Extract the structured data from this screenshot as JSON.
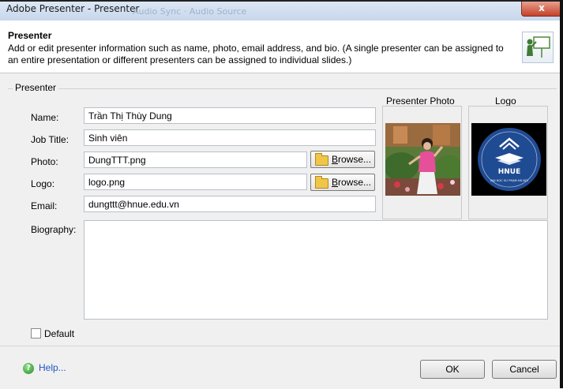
{
  "window": {
    "title": "Adobe Presenter - Presenter",
    "ghost_text": "Audio Sync · Audio Source",
    "close_label": "x"
  },
  "header": {
    "title": "Presenter",
    "description": "Add or edit presenter information such as name, photo, email address, and bio. (A single presenter can be assigned to an entire presentation or different presenters can be assigned to individual slides.)",
    "icon": "presenter-at-board-icon"
  },
  "form": {
    "group_label": "Presenter",
    "name_label": "Name:",
    "name_value": "Trần Thị Thùy Dung",
    "job_title_label": "Job Title:",
    "job_title_value": "Sinh viên",
    "photo_label": "Photo:",
    "photo_value": "DungTTT.png",
    "logo_label": "Logo:",
    "logo_value": "logo.png",
    "email_label": "Email:",
    "email_value": "dungttt@hnue.edu.vn",
    "biography_label": "Biography:",
    "biography_value": "",
    "browse_prefix": "B",
    "browse_rest": "rowse...",
    "default_label": "Default",
    "default_checked": false
  },
  "preview": {
    "photo_header": "Presenter Photo",
    "logo_header": "Logo",
    "logo_text": "HNUE",
    "logo_ring_text": "ĐẠI HỌC SƯ PHẠM HÀ NỘI"
  },
  "footer": {
    "help_label": "Help...",
    "ok_label": "OK",
    "cancel_label": "Cancel"
  },
  "colors": {
    "dialog_bg": "#f0f0f0",
    "link": "#1a56c2",
    "logo_blue": "#1f4b93"
  }
}
